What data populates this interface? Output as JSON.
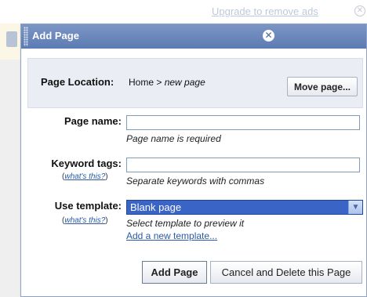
{
  "background": {
    "upgrade_link": "Upgrade to remove ads"
  },
  "dialog": {
    "title": "Add Page",
    "page_location": {
      "label": "Page Location:",
      "path": "Home >",
      "current": "new page",
      "move_button": "Move page..."
    },
    "page_name": {
      "label": "Page name:",
      "value": "",
      "hint": "Page name is required"
    },
    "keyword_tags": {
      "label": "Keyword tags:",
      "help_open": "(",
      "help_link": "what's this?",
      "help_close": ")",
      "value": "",
      "hint": "Separate keywords with commas"
    },
    "use_template": {
      "label": "Use template:",
      "help_open": "(",
      "help_link": "what's this?",
      "help_close": ")",
      "selected": "Blank page",
      "hint": "Select template to preview it",
      "add_link": "Add a new template..."
    },
    "buttons": {
      "add": "Add Page",
      "cancel": "Cancel and Delete this Page"
    }
  },
  "icons": {
    "close": "close-icon",
    "dropdown": "chevron-down-icon",
    "grip": "grip-icon"
  },
  "colors": {
    "titlebar": "#5c7bb4",
    "select_bg": "#3a64c6",
    "link": "#2a5aa8"
  }
}
